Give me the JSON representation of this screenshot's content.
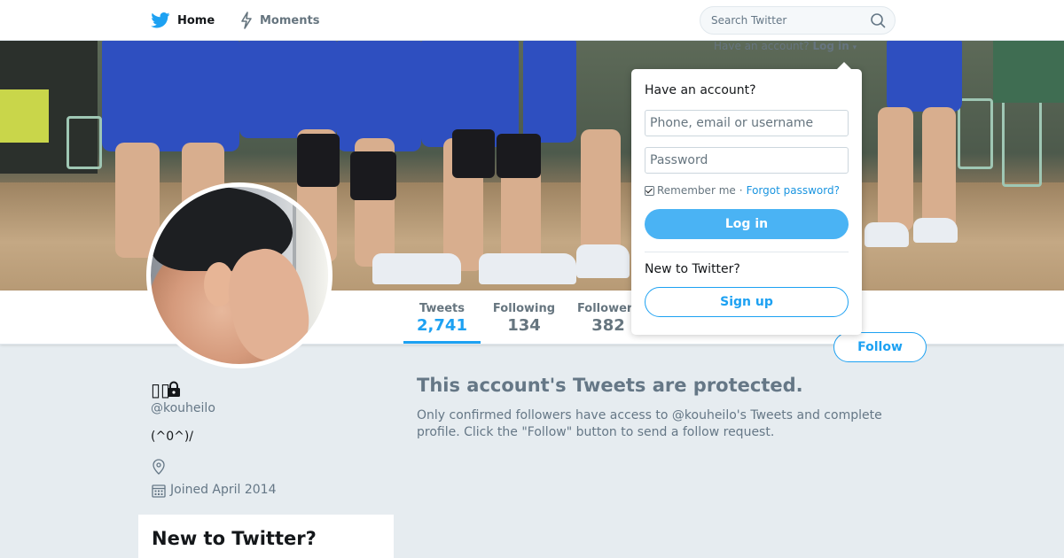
{
  "nav": {
    "home_label": "Home",
    "moments_label": "Moments",
    "search_placeholder": "Search Twitter"
  },
  "header": {
    "have_account": "Have an account?",
    "login_label": "Log in"
  },
  "profile": {
    "display_name": "▯▯",
    "handle": "@kouheilo",
    "bio": "(^0^)/",
    "joined": "Joined April 2014"
  },
  "stats": [
    {
      "label": "Tweets",
      "value": "2,741"
    },
    {
      "label": "Following",
      "value": "134"
    },
    {
      "label": "Followers",
      "value": "382"
    }
  ],
  "follow_label": "Follow",
  "protected": {
    "title": "This account's Tweets are protected.",
    "text": "Only confirmed followers have access to @kouheilo's Tweets and complete profile. Click the \"Follow\" button to send a follow request."
  },
  "new_card": {
    "title": "New to Twitter?"
  },
  "login_dropdown": {
    "title": "Have an account?",
    "username_placeholder": "Phone, email or username",
    "password_placeholder": "Password",
    "remember_label": "Remember me",
    "separator": "·",
    "forgot_label": "Forgot password?",
    "login_button": "Log in",
    "new_label": "New to Twitter?",
    "signup_button": "Sign up"
  },
  "colors": {
    "brand_blue": "#1da1f2",
    "background": "#e6ecf0"
  }
}
